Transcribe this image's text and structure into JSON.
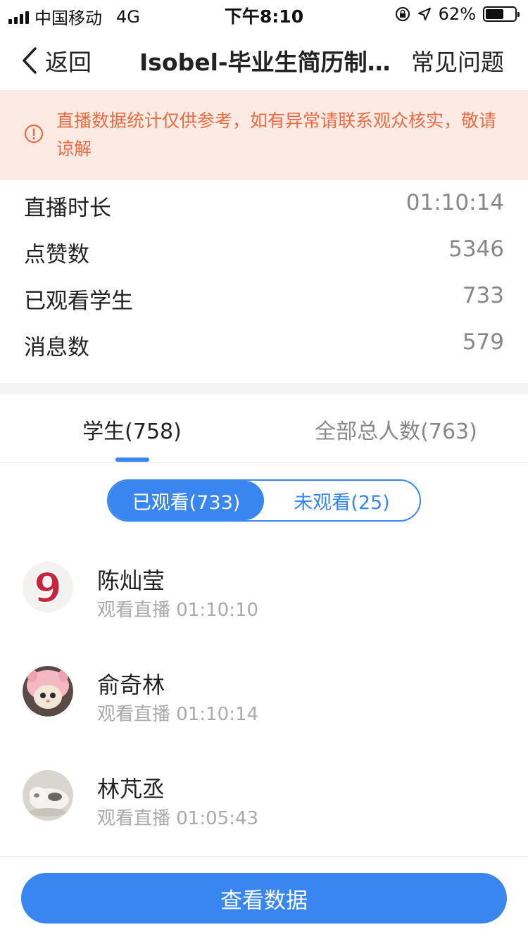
{
  "status_bar": {
    "carrier": "中国移动",
    "network": "4G",
    "time": "下午8:10",
    "battery": "62%",
    "battery_level": 0.62
  },
  "nav": {
    "back_label": "返回",
    "title": "Isobel-毕业生简历制…",
    "faq_label": "常见问题"
  },
  "notice": {
    "text": "直播数据统计仅供参考，如有异常请联系观众核实，敬请谅解"
  },
  "stats": [
    {
      "label": "直播时长",
      "value": "01:10:14"
    },
    {
      "label": "点赞数",
      "value": "5346"
    },
    {
      "label": "已观看学生",
      "value": "733"
    },
    {
      "label": "消息数",
      "value": "579"
    }
  ],
  "tabs": {
    "students": "学生(758)",
    "total": "全部总人数(763)"
  },
  "segment": {
    "watched": "已观看(733)",
    "unwatched": "未观看(25)"
  },
  "students": [
    {
      "name": "陈灿莹",
      "sub": "观看直播 01:10:10",
      "avatar_icon": "number-nine-avatar"
    },
    {
      "name": "俞奇林",
      "sub": "观看直播 01:10:14",
      "avatar_icon": "pink-cat-avatar"
    },
    {
      "name": "林芃丞",
      "sub": "观看直播 01:05:43",
      "avatar_icon": "cat-photo-avatar"
    }
  ],
  "cta": {
    "label": "查看数据"
  },
  "colors": {
    "accent": "#3a86f0",
    "notice_bg": "#fcebe5",
    "notice_text": "#ec6a3f"
  }
}
